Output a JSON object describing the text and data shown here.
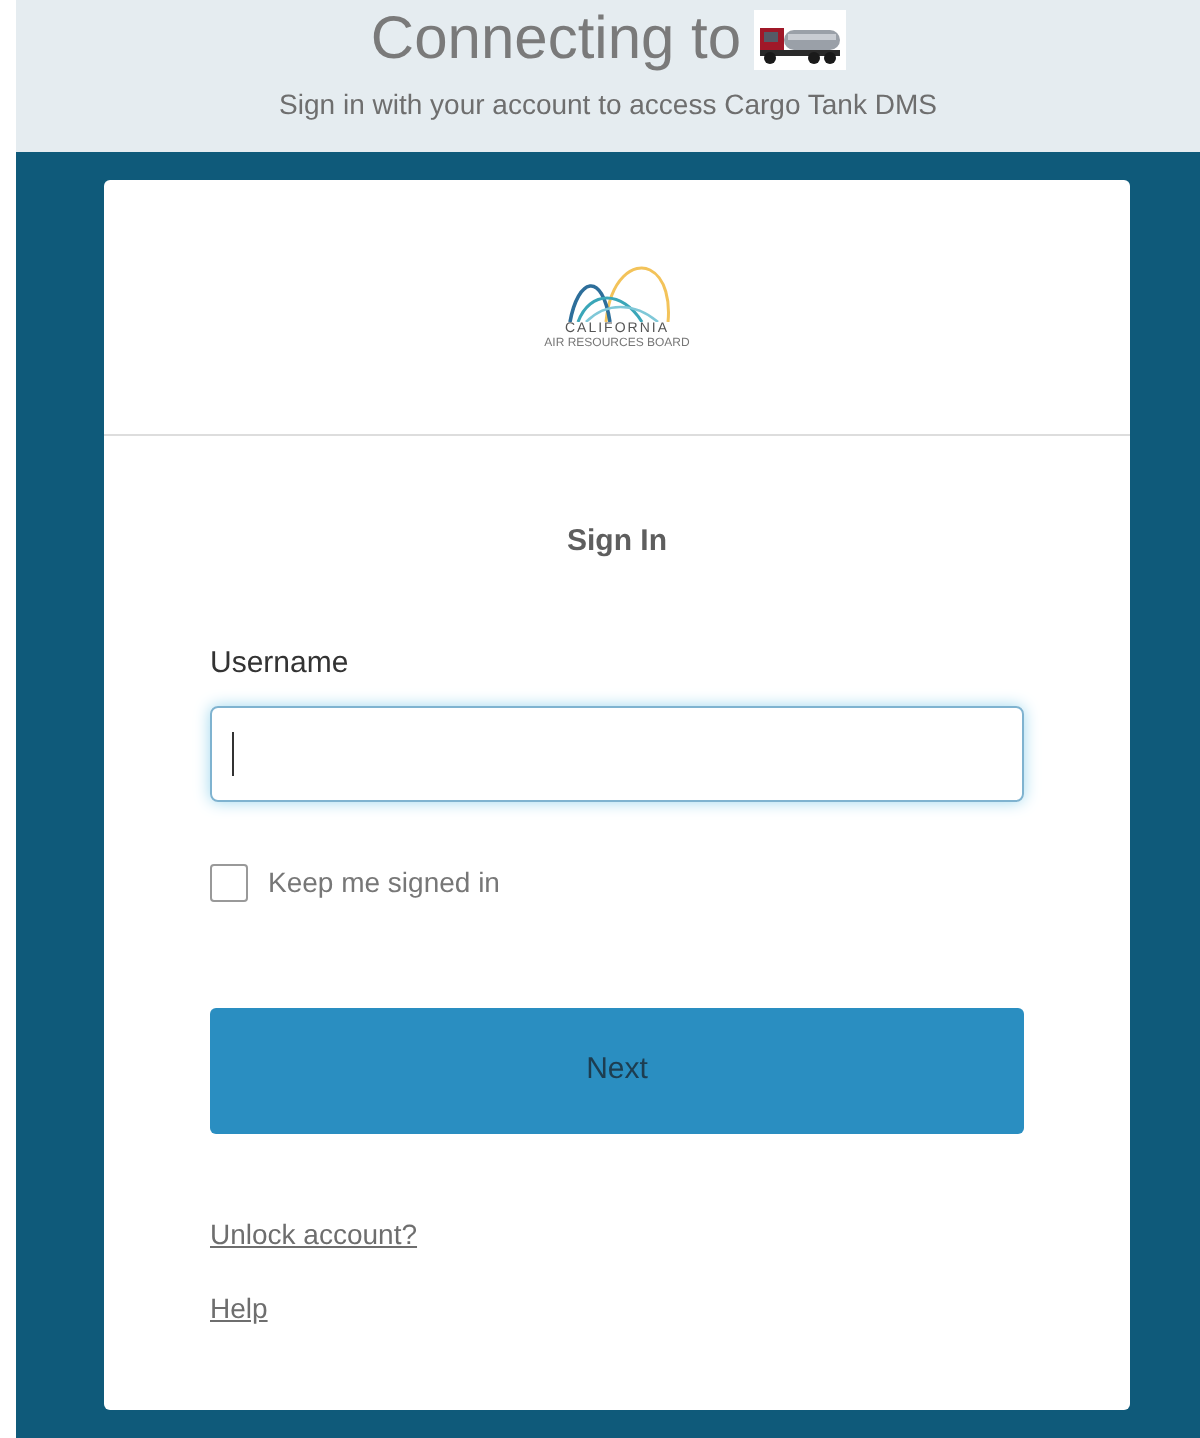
{
  "header": {
    "title": "Connecting to",
    "subtitle": "Sign in with your account to access Cargo Tank DMS"
  },
  "logo": {
    "name": "CALIFORNIA",
    "tagline": "AIR RESOURCES BOARD"
  },
  "form": {
    "heading": "Sign In",
    "username_label": "Username",
    "focused": true,
    "remember": {
      "label": "Keep me signed in",
      "checked": false
    },
    "submit": "Next",
    "links": [
      "Unlock account?",
      "Help"
    ]
  }
}
